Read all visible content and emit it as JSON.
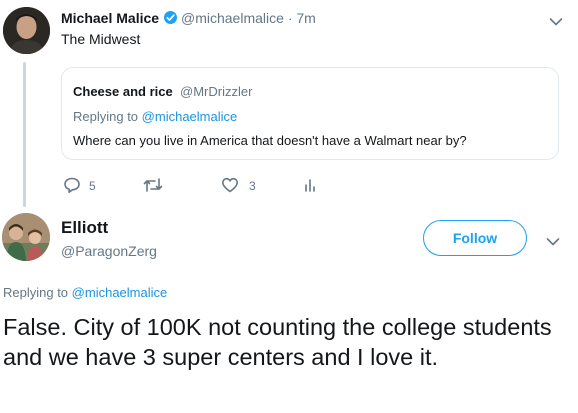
{
  "colors": {
    "accent": "#1da1f2",
    "link": "#1b95e0",
    "muted": "#657786",
    "text": "#14171a",
    "border": "#e1e8ed",
    "thread_line": "#ccd6dd"
  },
  "tweet": {
    "author_name": "Michael Malice",
    "verified_icon": "verified-badge-icon",
    "author_handle": "@michaelmalice",
    "separator": "·",
    "time": "7m",
    "text": "The Midwest",
    "quoted": {
      "author_name": "Cheese and rice",
      "author_handle": "@MrDrizzler",
      "replying_prefix": "Replying to",
      "replying_handle": "@michaelmalice",
      "text": "Where can you live in America that doesn't have a Walmart near by?"
    },
    "actions": {
      "reply_icon": "reply-icon",
      "reply_count": "5",
      "retweet_icon": "retweet-icon",
      "like_icon": "heart-icon",
      "like_count": "3",
      "analytics_icon": "analytics-icon"
    }
  },
  "reply": {
    "author_name": "Elliott",
    "author_handle": "@ParagonZerg",
    "follow_label": "Follow",
    "replying_prefix": "Replying to",
    "replying_handle": "@michaelmalice",
    "text": "False. City of 100K not counting the college students and we have 3 super centers and I love it."
  }
}
